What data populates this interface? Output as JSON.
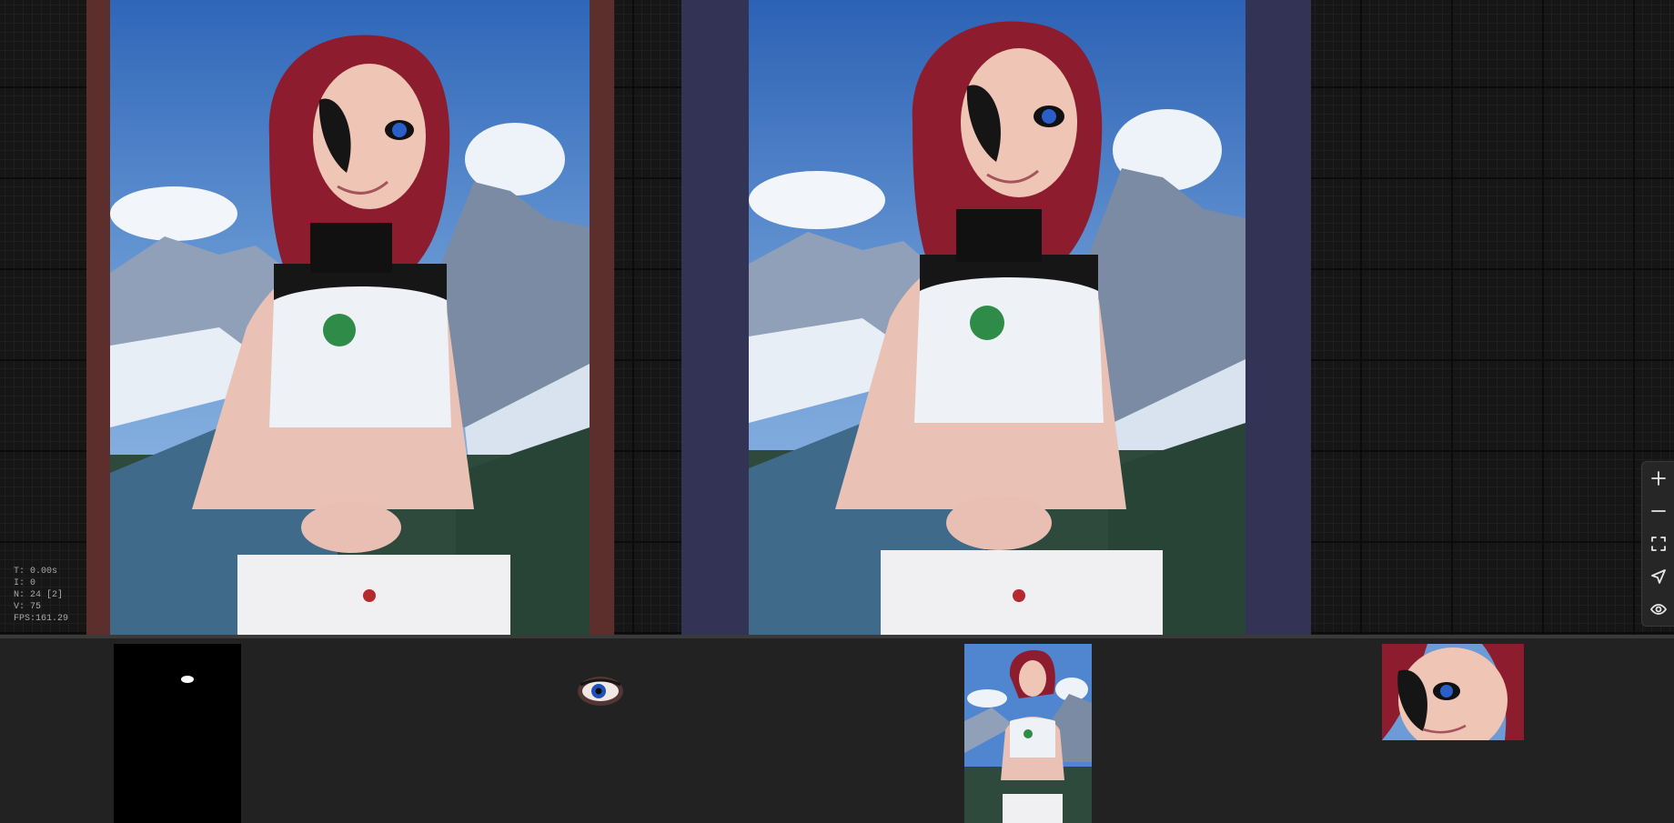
{
  "stats": {
    "time": "T: 0.00s",
    "iteration": "I: 0",
    "nodes": "N: 24 [2]",
    "vertices": "V: 75",
    "fps": "FPS:161.29"
  },
  "canvas": {
    "nodes": [
      {
        "name": "image-preview-left",
        "color": "#5c2f2c"
      },
      {
        "name": "image-preview-right",
        "color": "#333355"
      }
    ]
  },
  "toolbar": {
    "buttons": [
      {
        "name": "zoom-in-button",
        "icon": "plus-icon"
      },
      {
        "name": "zoom-out-button",
        "icon": "minus-icon"
      },
      {
        "name": "fit-view-button",
        "icon": "fullscreen-icon"
      },
      {
        "name": "locate-button",
        "icon": "navigation-arrow-icon"
      },
      {
        "name": "toggle-visibility-button",
        "icon": "eye-icon"
      }
    ]
  },
  "output_strip": {
    "thumbnails": [
      {
        "name": "mask-thumbnail",
        "kind": "mask"
      },
      {
        "name": "eye-crop-thumbnail",
        "kind": "crop"
      },
      {
        "name": "full-image-thumbnail",
        "kind": "image"
      },
      {
        "name": "face-crop-thumbnail",
        "kind": "crop"
      }
    ]
  }
}
